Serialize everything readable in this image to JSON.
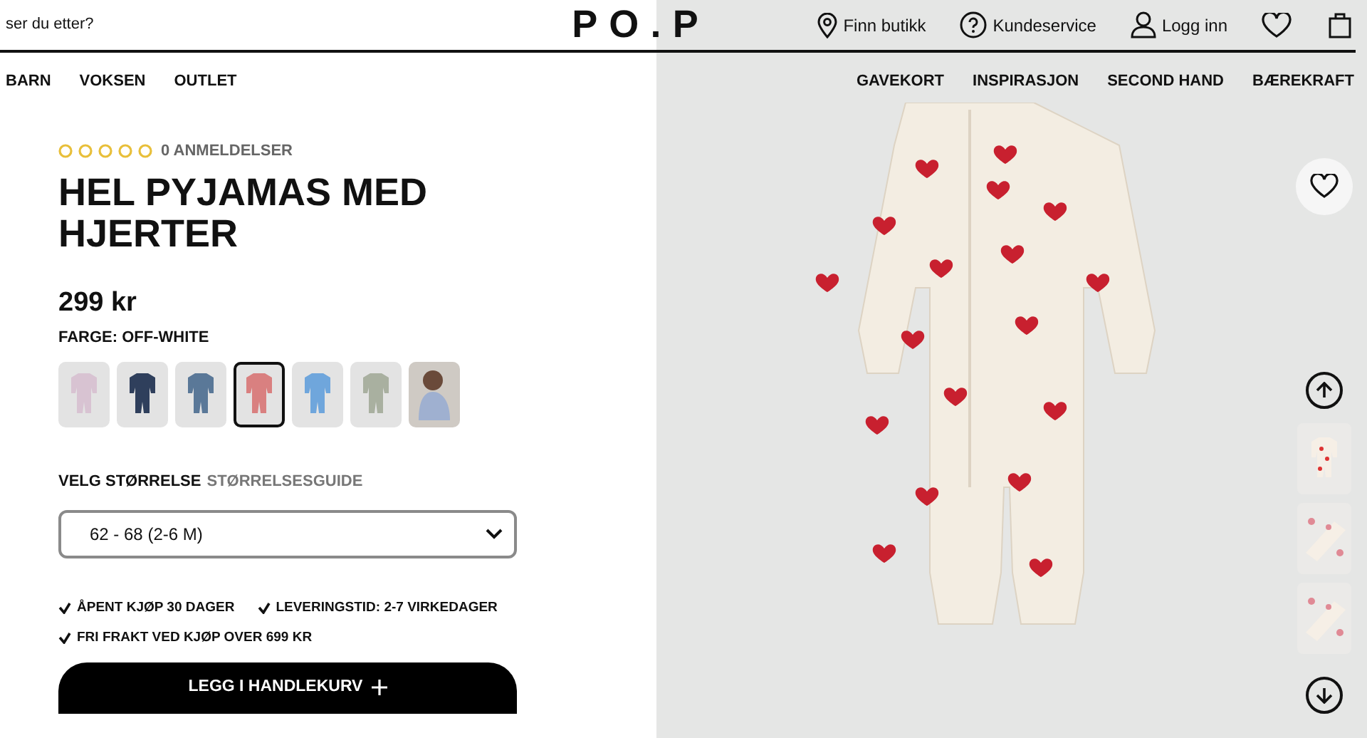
{
  "header": {
    "search_text": "ser du etter?",
    "logo": "PO.P",
    "links": [
      {
        "kind": "store",
        "label": "Finn butikk"
      },
      {
        "kind": "help",
        "label": "Kundeservice"
      },
      {
        "kind": "account",
        "label": "Logg inn"
      }
    ]
  },
  "nav_left": [
    "BARN",
    "VOKSEN",
    "OUTLET"
  ],
  "nav_right": [
    "GAVEKORT",
    "INSPIRASJON",
    "SECOND HAND",
    "BÆREKRAFT"
  ],
  "product": {
    "stars": 0,
    "reviews": "0 ANMELDELSER",
    "title": "HEL PYJAMAS MED HJERTER",
    "price": "299 kr",
    "color_label": "FARGE: OFF-WHITE",
    "swatches": [
      {
        "kind": "product",
        "color": "#d8c3d2",
        "selected": false
      },
      {
        "kind": "product",
        "color": "#2f3f5c",
        "selected": false
      },
      {
        "kind": "product",
        "color": "#5a7898",
        "selected": false
      },
      {
        "kind": "product",
        "color": "#d98080",
        "selected": true
      },
      {
        "kind": "product",
        "color": "#6fa6dc",
        "selected": false
      },
      {
        "kind": "product",
        "color": "#a9b0a0",
        "selected": false
      },
      {
        "kind": "model",
        "color": "#9fb0d0",
        "selected": false
      }
    ],
    "size_label": "VELG STØRRELSE",
    "size_guide": "STØRRELSESGUIDE",
    "size_value": "62 - 68 (2-6 M)",
    "perks": [
      "ÅPENT KJØP 30 DAGER",
      "LEVERINGSTID: 2-7 VIRKEDAGER",
      "FRI FRAKT VED KJØP OVER 699 KR"
    ],
    "add_to_cart": "LEGG I HANDLEKURV"
  },
  "gallery": {
    "thumbnails": [
      {
        "kind": "full"
      },
      {
        "kind": "detail"
      },
      {
        "kind": "detail"
      }
    ]
  }
}
